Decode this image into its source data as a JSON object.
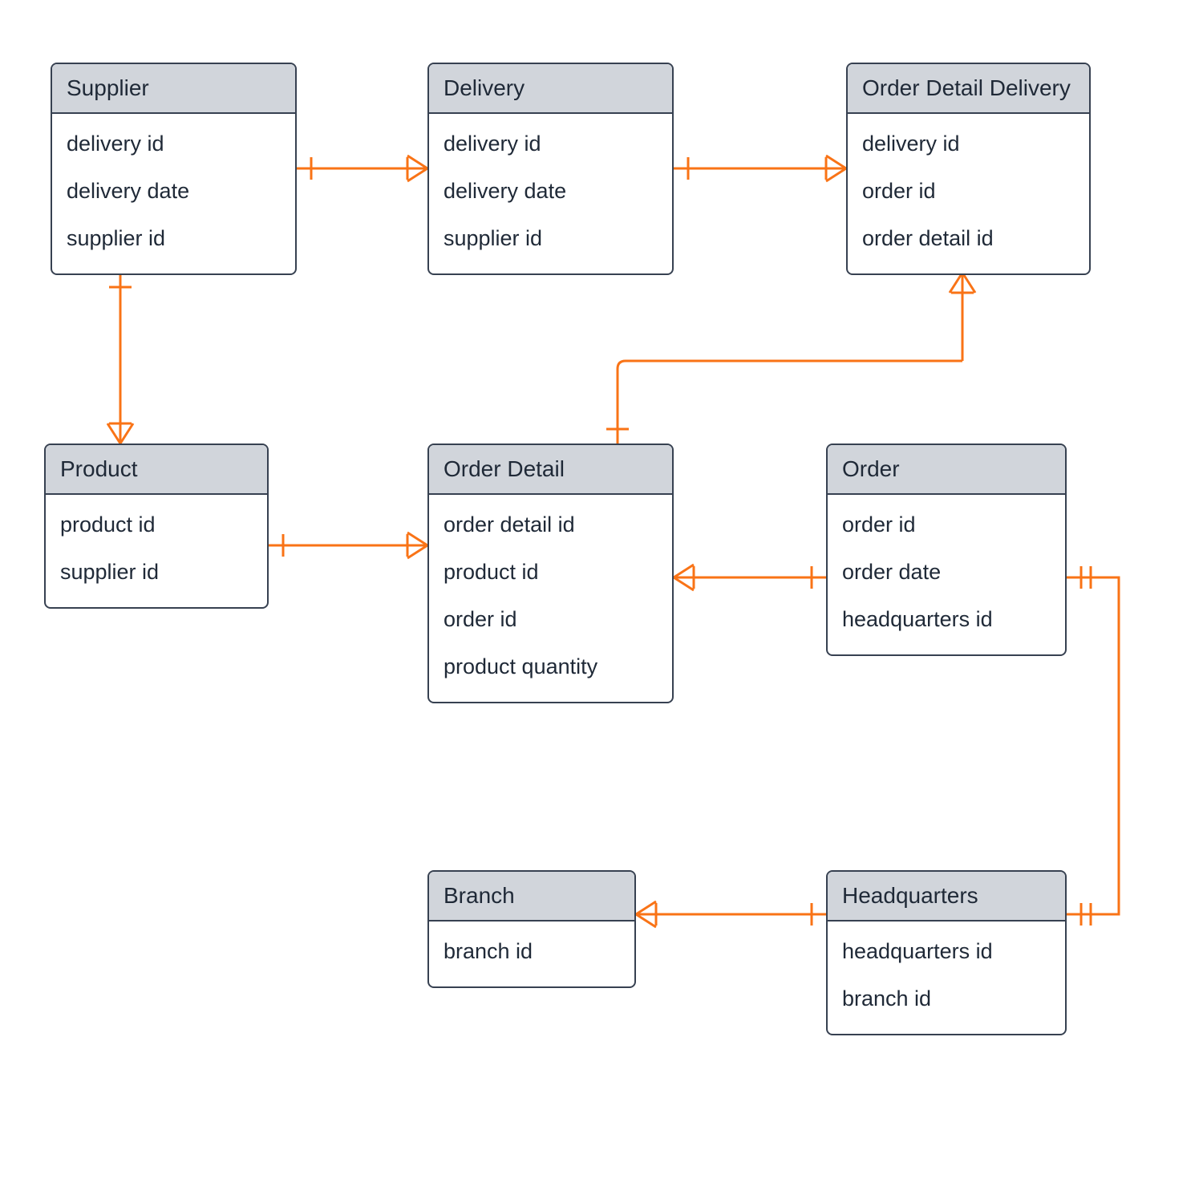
{
  "entities": {
    "supplier": {
      "title": "Supplier",
      "attrs": [
        "delivery id",
        "delivery date",
        "supplier id"
      ]
    },
    "delivery": {
      "title": "Delivery",
      "attrs": [
        "delivery id",
        "delivery date",
        "supplier id"
      ]
    },
    "order_detail_delivery": {
      "title": "Order Detail Delivery",
      "attrs": [
        "delivery id",
        "order id",
        "order detail id"
      ]
    },
    "product": {
      "title": "Product",
      "attrs": [
        "product id",
        "supplier id"
      ]
    },
    "order_detail": {
      "title": "Order Detail",
      "attrs": [
        "order detail id",
        "product id",
        "order id",
        "product quantity"
      ]
    },
    "order": {
      "title": "Order",
      "attrs": [
        "order id",
        "order date",
        "headquarters id"
      ]
    },
    "branch": {
      "title": "Branch",
      "attrs": [
        "branch id"
      ]
    },
    "headquarters": {
      "title": "Headquarters",
      "attrs": [
        "headquarters id",
        "branch id"
      ]
    }
  },
  "relationships": [
    {
      "from": "supplier",
      "to": "delivery",
      "type": "one-to-many"
    },
    {
      "from": "delivery",
      "to": "order_detail_delivery",
      "type": "one-to-many"
    },
    {
      "from": "supplier",
      "to": "product",
      "type": "one-to-many"
    },
    {
      "from": "product",
      "to": "order_detail",
      "type": "one-to-many"
    },
    {
      "from": "order_detail",
      "to": "order_detail_delivery",
      "type": "many-to-one"
    },
    {
      "from": "order_detail",
      "to": "order",
      "type": "many-to-one"
    },
    {
      "from": "branch",
      "to": "headquarters",
      "type": "many-to-one"
    },
    {
      "from": "headquarters",
      "to": "order",
      "type": "one-to-one"
    }
  ],
  "colors": {
    "line": "#f97316",
    "border": "#374151",
    "header_bg": "#d1d5db"
  }
}
